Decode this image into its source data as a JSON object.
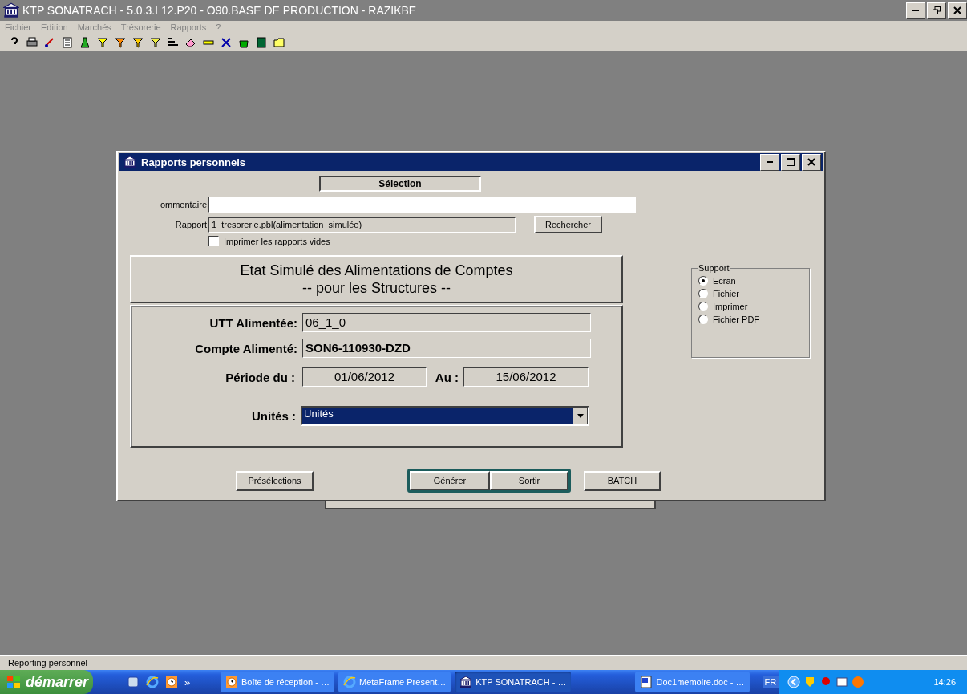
{
  "app_window": {
    "title": "KTP SONATRACH - 5.0.3.L12.P20 - O90.BASE DE PRODUCTION - RAZIKBE"
  },
  "menu": [
    "Fichier",
    "Edition",
    "Marchés",
    "Trésorerie",
    "Rapports",
    "?"
  ],
  "dialog": {
    "title": "Rapports personnels",
    "section_tab": "Sélection",
    "commentaire": {
      "label": "ommentaire"
    },
    "rapport": {
      "label": "Rapport",
      "value": "1_tresorerie.pbl(alimentation_simulée)",
      "button": "Rechercher"
    },
    "print_empty": {
      "label": "Imprimer les rapports vides",
      "checked": false
    },
    "report_title": [
      "Etat Simulé des Alimentations de Comptes",
      "-- pour les Structures --"
    ],
    "utt": {
      "label": "UTT Alimentée:",
      "value": "06_1_0"
    },
    "compte": {
      "label": "Compte Alimenté:",
      "value": "SON6-110930-DZD"
    },
    "periode": {
      "label": "Période du :",
      "from": "01/06/2012",
      "to_label": "Au :",
      "to": "15/06/2012"
    },
    "unites": {
      "label": "Unités :",
      "value": "Unités"
    },
    "support": {
      "title": "Support",
      "options": [
        {
          "label": "Ecran",
          "selected": true
        },
        {
          "label": "Fichier",
          "selected": false
        },
        {
          "label": "Imprimer",
          "selected": false
        },
        {
          "label": "Fichier PDF",
          "selected": false
        }
      ]
    },
    "buttons": {
      "preselections": "Présélections",
      "generer": "Générer",
      "sortir": "Sortir",
      "batch": "BATCH"
    }
  },
  "status_bar": "Reporting personnel",
  "taskbar": {
    "start": "démarrer",
    "more": "»",
    "tasks": [
      {
        "label": "Boîte de réception - …",
        "kind": "clock",
        "selected": false
      },
      {
        "label": "MetaFrame Present…",
        "kind": "browser",
        "selected": false
      },
      {
        "label": "KTP SONATRACH - …",
        "kind": "bank",
        "selected": true
      },
      {
        "label": "Doc1memoire.doc - …",
        "kind": "doc",
        "selected": false
      }
    ],
    "language": "FR",
    "clock": "14:26"
  }
}
